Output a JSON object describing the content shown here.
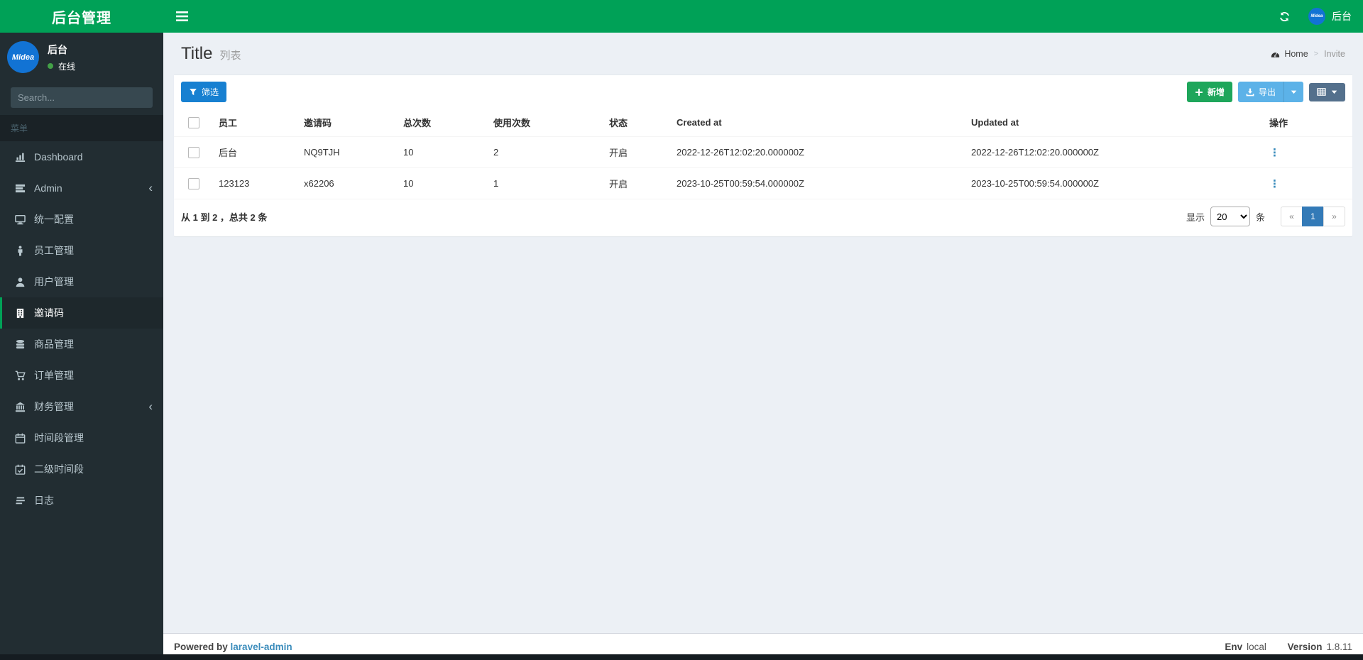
{
  "app": {
    "logo": "后台管理"
  },
  "navbar": {
    "user_label": "后台",
    "avatar_text": "Midea"
  },
  "sidebar": {
    "user": {
      "name": "后台",
      "status": "在线",
      "avatar_text": "Midea"
    },
    "search_placeholder": "Search...",
    "menu_header": "菜单",
    "items": [
      {
        "id": "dashboard",
        "label": "Dashboard",
        "icon": "bar-chart",
        "active": false,
        "chevron": false
      },
      {
        "id": "admin",
        "label": "Admin",
        "icon": "tasks",
        "active": false,
        "chevron": true
      },
      {
        "id": "unified-config",
        "label": "统一配置",
        "icon": "desktop",
        "active": false,
        "chevron": false
      },
      {
        "id": "staff",
        "label": "员工管理",
        "icon": "male",
        "active": false,
        "chevron": false
      },
      {
        "id": "users",
        "label": "用户管理",
        "icon": "user",
        "active": false,
        "chevron": false
      },
      {
        "id": "invite-code",
        "label": "邀请码",
        "icon": "building",
        "active": true,
        "chevron": false
      },
      {
        "id": "products",
        "label": "商品管理",
        "icon": "database",
        "active": false,
        "chevron": false
      },
      {
        "id": "orders",
        "label": "订单管理",
        "icon": "cart",
        "active": false,
        "chevron": false
      },
      {
        "id": "finance",
        "label": "财务管理",
        "icon": "bank",
        "active": false,
        "chevron": true
      },
      {
        "id": "timeslot",
        "label": "时间段管理",
        "icon": "calendar",
        "active": false,
        "chevron": false
      },
      {
        "id": "sub-timeslot",
        "label": "二级时间段",
        "icon": "calendar-check",
        "active": false,
        "chevron": false
      },
      {
        "id": "logs",
        "label": "日志",
        "icon": "logs",
        "active": false,
        "chevron": false
      }
    ]
  },
  "header": {
    "title": "Title",
    "subtitle": "列表",
    "breadcrumb_home": "Home",
    "breadcrumb_current": "Invite"
  },
  "toolbar": {
    "filter_label": "筛选",
    "add_label": "新增",
    "export_label": "导出"
  },
  "table": {
    "columns": [
      "员工",
      "邀请码",
      "总次数",
      "使用次数",
      "状态",
      "Created at",
      "Updated at",
      "操作"
    ],
    "rows": [
      [
        "后台",
        "NQ9TJH",
        "10",
        "2",
        "开启",
        "2022-12-26T12:02:20.000000Z",
        "2022-12-26T12:02:20.000000Z"
      ],
      [
        "123123",
        "x62206",
        "10",
        "1",
        "开启",
        "2023-10-25T00:59:54.000000Z",
        "2023-10-25T00:59:54.000000Z"
      ]
    ]
  },
  "pagination": {
    "summary": "从 1 到 2 ，总共 2 条",
    "show_label": "显示",
    "per_page": "20",
    "unit_label": "条",
    "prev": "«",
    "page": "1",
    "next": "»"
  },
  "footer": {
    "powered_by": "Powered by",
    "powered_link": "laravel-admin",
    "env_label": "Env",
    "env_value": "local",
    "version_label": "Version",
    "version_value": "1.8.11"
  },
  "colors": {
    "brand_green": "#00a157",
    "sidebar_bg": "#222d32",
    "sidebar_active_bg": "#1e282c",
    "content_bg": "#ecf0f5",
    "avatar_blue": "#1273d4",
    "status_green": "#43a047",
    "filter_blue": "#1780d1",
    "add_green": "#1ea65b",
    "export_blue": "#5cb2e8",
    "grid_slate": "#54708c",
    "link_blue": "#3c8dbc",
    "pager_active": "#337ab7"
  }
}
